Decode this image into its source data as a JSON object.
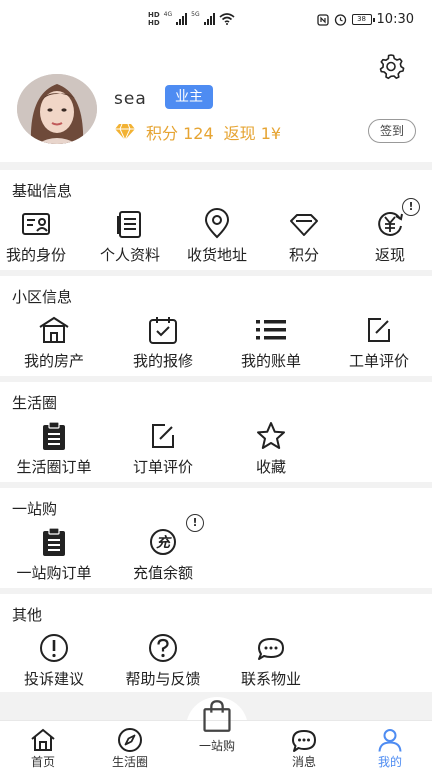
{
  "status": {
    "time": "10:30",
    "battery": "38",
    "net1": "4G",
    "net2": "5G"
  },
  "profile": {
    "username": "sea",
    "role": "业主",
    "points": "积分 124",
    "cashback": "返现 1¥",
    "checkin_label": "签到"
  },
  "sections": {
    "basic": {
      "title": "基础信息",
      "items": [
        {
          "label": "我的身份",
          "icon": "id-card-icon"
        },
        {
          "label": "个人资料",
          "icon": "document-icon"
        },
        {
          "label": "收货地址",
          "icon": "location-pin-icon"
        },
        {
          "label": "积分",
          "icon": "diamond-icon"
        },
        {
          "label": "返现",
          "icon": "yuan-refresh-icon"
        }
      ]
    },
    "community": {
      "title": "小区信息",
      "items": [
        {
          "label": "我的房产",
          "icon": "house-icon"
        },
        {
          "label": "我的报修",
          "icon": "calendar-check-icon"
        },
        {
          "label": "我的账单",
          "icon": "list-icon"
        },
        {
          "label": "工单评价",
          "icon": "edit-icon"
        }
      ]
    },
    "life": {
      "title": "生活圈",
      "items": [
        {
          "label": "生活圈订单",
          "icon": "clipboard-icon"
        },
        {
          "label": "订单评价",
          "icon": "edit-icon"
        },
        {
          "label": "收藏",
          "icon": "star-icon"
        }
      ]
    },
    "onestop": {
      "title": "一站购",
      "items": [
        {
          "label": "一站购订单",
          "icon": "clipboard-icon"
        },
        {
          "label": "充值余额",
          "icon": "recharge-icon"
        }
      ]
    },
    "other": {
      "title": "其他",
      "items": [
        {
          "label": "投诉建议",
          "icon": "exclamation-icon"
        },
        {
          "label": "帮助与反馈",
          "icon": "question-icon"
        },
        {
          "label": "联系物业",
          "icon": "chat-icon"
        }
      ]
    }
  },
  "tabbar": {
    "items": [
      {
        "label": "首页"
      },
      {
        "label": "生活圈"
      },
      {
        "label": "一站购"
      },
      {
        "label": "消息"
      },
      {
        "label": "我的"
      }
    ],
    "active_color": "#4e8cf2"
  },
  "colors": {
    "accent": "#4e8cf2",
    "points": "#e6a432"
  }
}
